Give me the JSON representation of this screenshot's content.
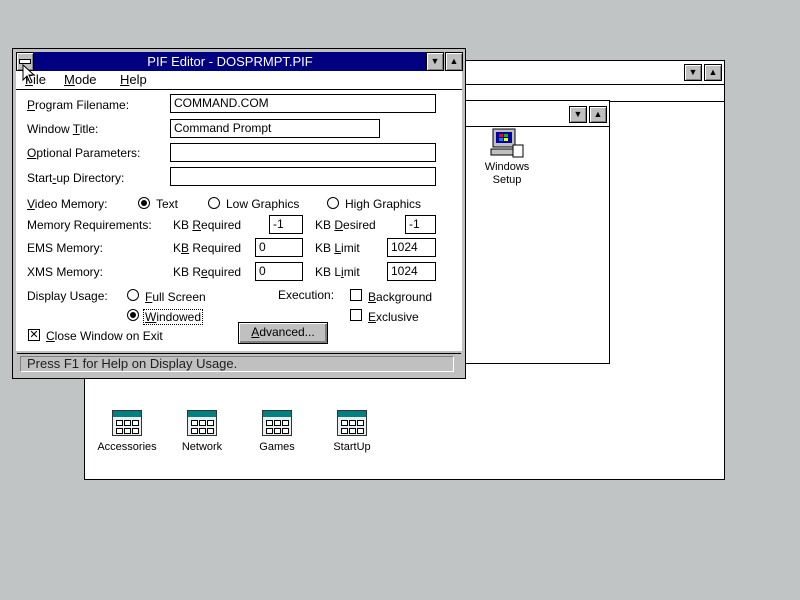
{
  "program_manager": {
    "title": "",
    "groups": [
      {
        "label": "Accessories"
      },
      {
        "label": "Network"
      },
      {
        "label": "Games"
      },
      {
        "label": "StartUp"
      }
    ]
  },
  "main_group_window": {
    "title": "",
    "icons": [
      {
        "label_line1": "Windows",
        "label_line2": "Setup"
      }
    ]
  },
  "pif_editor": {
    "title": "PIF Editor - DOSPRMPT.PIF",
    "menu": [
      {
        "label": "File",
        "accel": "F",
        "rest": "ile"
      },
      {
        "label": "Mode",
        "accel": "M",
        "rest": "ode"
      },
      {
        "label": "Help",
        "accel": "H",
        "rest": "elp"
      }
    ],
    "program_filename": {
      "label_accel": "P",
      "label_rest": "rogram Filename:",
      "value": "COMMAND.COM"
    },
    "window_title": {
      "label_a": "Window ",
      "label_accel": "T",
      "label_rest": "itle:",
      "value": "Command Prompt"
    },
    "optional_parameters": {
      "label_accel": "O",
      "label_rest": "ptional Parameters:",
      "value": ""
    },
    "startup_directory": {
      "label_a": "Start",
      "label_accel": "-",
      "label_rest": "up Directory:",
      "value": ""
    },
    "video_memory": {
      "label_accel": "V",
      "label_rest": "ideo Memory:",
      "options": [
        {
          "label": "Text",
          "selected": true
        },
        {
          "label": "Low Graphics",
          "selected": false
        },
        {
          "label": "High Graphics",
          "selected": false
        }
      ]
    },
    "memory_requirements": {
      "label": "Memory Requirements:",
      "kb_required_label_a": "KB ",
      "kb_required_accel": "R",
      "kb_required_rest": "equired",
      "kb_required": "-1",
      "kb_desired_label_a": "KB ",
      "kb_desired_accel": "D",
      "kb_desired_rest": "esired",
      "kb_desired": "-1"
    },
    "ems_memory": {
      "label": "EMS Memory:",
      "kb_required_label_a": "K",
      "kb_required_accel": "B",
      "kb_required_rest": " Required",
      "kb_required": "0",
      "kb_limit_label_a": "KB ",
      "kb_limit_accel": "L",
      "kb_limit_rest": "imit",
      "kb_limit": "1024"
    },
    "xms_memory": {
      "label": "XMS Memory:",
      "kb_required_label_a": "KB R",
      "kb_required_accel": "e",
      "kb_required_rest": "quired",
      "kb_required": "0",
      "kb_limit_label_a": "KB L",
      "kb_limit_accel": "i",
      "kb_limit_rest": "mit",
      "kb_limit": "1024"
    },
    "display_usage": {
      "label": "Display Usage:",
      "options": [
        {
          "label_accel": "F",
          "label_rest": "ull Screen",
          "selected": false
        },
        {
          "label_accel": "W",
          "label_rest": "indowed",
          "selected": true
        }
      ]
    },
    "execution": {
      "label": "Execution:",
      "background": {
        "label_accel": "B",
        "label_rest": "ackground",
        "checked": false
      },
      "exclusive": {
        "label_accel": "E",
        "label_rest": "xclusive",
        "checked": false
      }
    },
    "close_on_exit": {
      "label_accel": "C",
      "label_rest": "lose Window on Exit",
      "checked": true
    },
    "advanced_button": {
      "label_accel": "A",
      "label_rest": "dvanced..."
    },
    "status": "Press F1 for Help on Display Usage."
  },
  "colors": {
    "desktop": "#c0c4c4",
    "titlebar_active": "#000080"
  }
}
